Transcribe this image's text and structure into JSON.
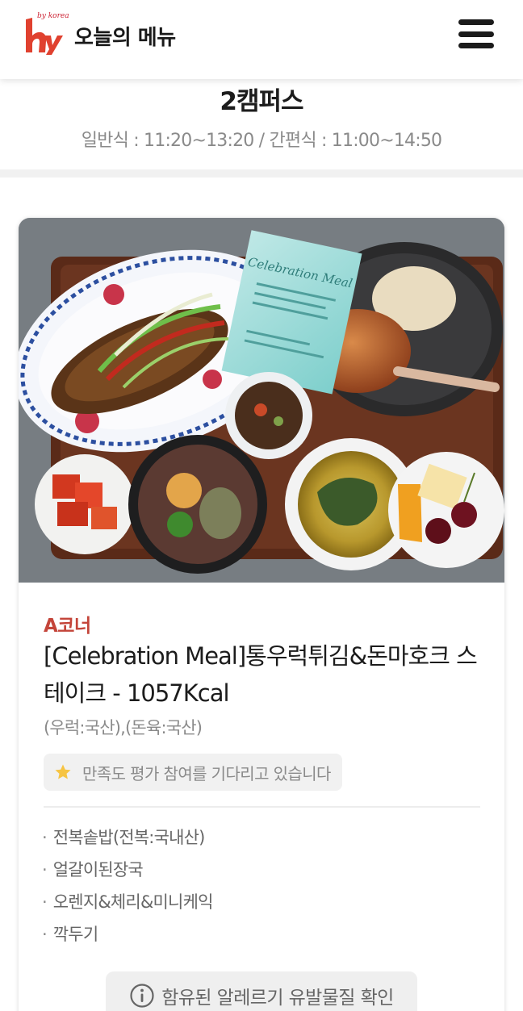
{
  "header": {
    "logo_by_text": "by korea",
    "app_title": "오늘의 메뉴",
    "menu_icon": "hamburger-menu-icon",
    "logo_color": "#e0412f"
  },
  "campus": {
    "name": "2캠퍼스",
    "hours": "일반식 : 11:20~13:20 / 간편식 : 11:00~14:50"
  },
  "menu_card": {
    "photo_alt": "Celebration Meal",
    "corner": "A코너",
    "title": "[Celebration Meal]통우럭튀김&돈마호크 스테이크 - 1057Kcal",
    "origin": "(우럭:국산),(돈육:국산)",
    "rating_prompt": "만족도 평가 참여를 기다리고 있습니다",
    "rating_icon": "star-icon",
    "side_dishes": [
      "전복솥밥(전복:국내산)",
      "얼갈이된장국",
      "오렌지&체리&미니케익",
      "깍두기"
    ],
    "allergy_button": "함유된 알레르기 유발물질 확인",
    "allergy_icon": "info-icon",
    "accent_color": "#c4453a"
  },
  "card_text": {
    "celebration": "Celebration Meal"
  }
}
